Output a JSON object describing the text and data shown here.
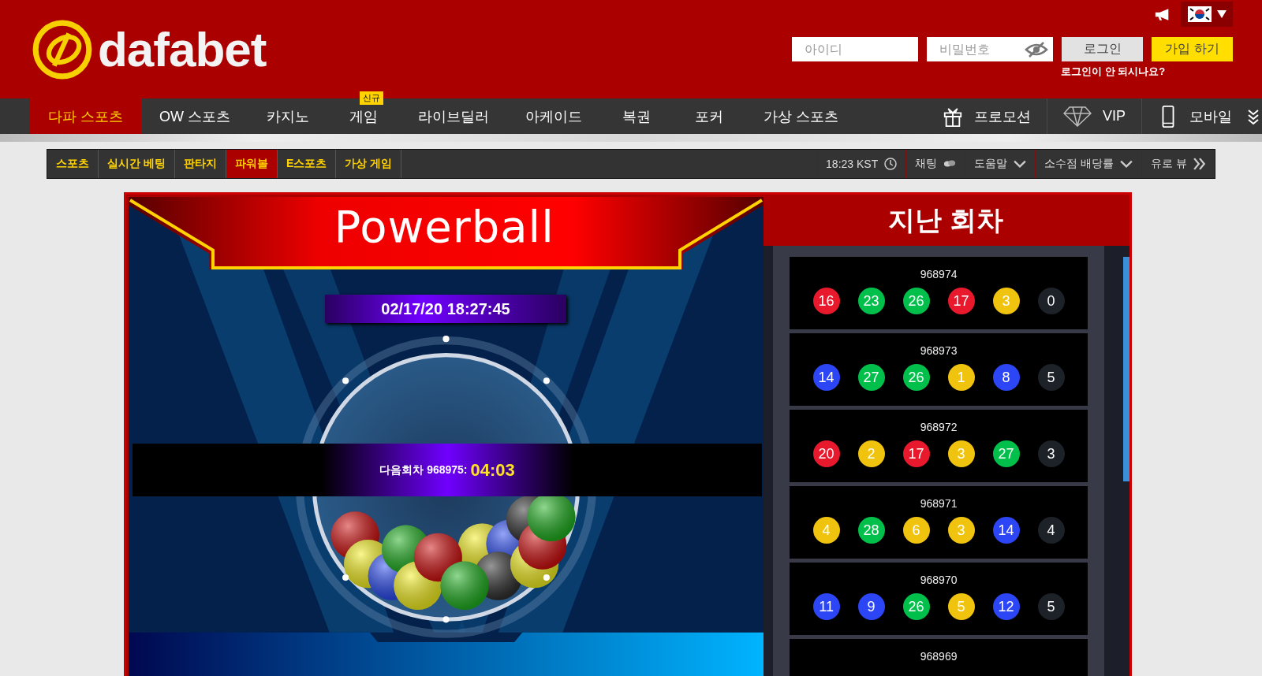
{
  "header": {
    "logo_text": "dafabet",
    "username_placeholder": "아이디",
    "password_placeholder": "비밀번호",
    "login_button": "로그인",
    "signup_button": "가입 하기",
    "login_help_link": "로그인이 안 되시나요?"
  },
  "main_nav": {
    "items": [
      {
        "label": "다파 스포츠",
        "selected": true
      },
      {
        "label": "OW 스포츠",
        "selected": false
      },
      {
        "label": "카지노",
        "selected": false
      },
      {
        "label": "게임",
        "selected": false,
        "badge": "신규"
      },
      {
        "label": "라이브딜러",
        "selected": false
      },
      {
        "label": "아케이드",
        "selected": false
      },
      {
        "label": "복권",
        "selected": false
      },
      {
        "label": "포커",
        "selected": false
      },
      {
        "label": "가상 스포츠",
        "selected": false
      }
    ],
    "right_items": [
      {
        "label": "프로모션",
        "kind": "gift"
      },
      {
        "label": "VIP",
        "kind": "diamond"
      },
      {
        "label": "모바일",
        "kind": "phone"
      }
    ]
  },
  "sub_nav": {
    "items": [
      {
        "label": "스포츠",
        "selected": false
      },
      {
        "label": "실시간 베팅",
        "selected": false
      },
      {
        "label": "판타지",
        "selected": false
      },
      {
        "label": "파워볼",
        "selected": true
      },
      {
        "label": "E스포츠",
        "selected": false
      },
      {
        "label": "가상 게임",
        "selected": false
      }
    ],
    "time": "18:23 KST",
    "right_items": [
      {
        "label": "채팅",
        "kind": "chat"
      },
      {
        "label": "도움말",
        "kind": "dropdown"
      },
      {
        "label": "소수점 배당률",
        "kind": "dropdown"
      },
      {
        "label": "유로 뷰",
        "kind": "double-chevron"
      }
    ]
  },
  "game": {
    "title": "Powerball",
    "datetime": "02/17/20 18:27:45",
    "next_round_label": "다음회차 968975:",
    "countdown": "04:03"
  },
  "results": {
    "title": "지난 회차",
    "rounds": [
      {
        "round": "968974",
        "balls": [
          {
            "number": "16",
            "color": "#e8192c"
          },
          {
            "number": "23",
            "color": "#00c04b"
          },
          {
            "number": "26",
            "color": "#00c04b"
          },
          {
            "number": "17",
            "color": "#e8192c"
          },
          {
            "number": "3",
            "color": "#f0c30f"
          },
          {
            "number": "0",
            "color": "#1c2228"
          }
        ]
      },
      {
        "round": "968973",
        "balls": [
          {
            "number": "14",
            "color": "#2c46f5"
          },
          {
            "number": "27",
            "color": "#00c04b"
          },
          {
            "number": "26",
            "color": "#00c04b"
          },
          {
            "number": "1",
            "color": "#f0c30f"
          },
          {
            "number": "8",
            "color": "#2c46f5"
          },
          {
            "number": "5",
            "color": "#1c2228"
          }
        ]
      },
      {
        "round": "968972",
        "balls": [
          {
            "number": "20",
            "color": "#e8192c"
          },
          {
            "number": "2",
            "color": "#f0c30f"
          },
          {
            "number": "17",
            "color": "#e8192c"
          },
          {
            "number": "3",
            "color": "#f0c30f"
          },
          {
            "number": "27",
            "color": "#00c04b"
          },
          {
            "number": "3",
            "color": "#1c2228"
          }
        ]
      },
      {
        "round": "968971",
        "balls": [
          {
            "number": "4",
            "color": "#f0c30f"
          },
          {
            "number": "28",
            "color": "#00c04b"
          },
          {
            "number": "6",
            "color": "#f0c30f"
          },
          {
            "number": "3",
            "color": "#f0c30f"
          },
          {
            "number": "14",
            "color": "#2c46f5"
          },
          {
            "number": "4",
            "color": "#1c2228"
          }
        ]
      },
      {
        "round": "968970",
        "balls": [
          {
            "number": "11",
            "color": "#2c46f5"
          },
          {
            "number": "9",
            "color": "#2c46f5"
          },
          {
            "number": "26",
            "color": "#00c04b"
          },
          {
            "number": "5",
            "color": "#f0c30f"
          },
          {
            "number": "12",
            "color": "#2c46f5"
          },
          {
            "number": "5",
            "color": "#1c2228"
          }
        ]
      },
      {
        "round": "968969"
      }
    ]
  }
}
